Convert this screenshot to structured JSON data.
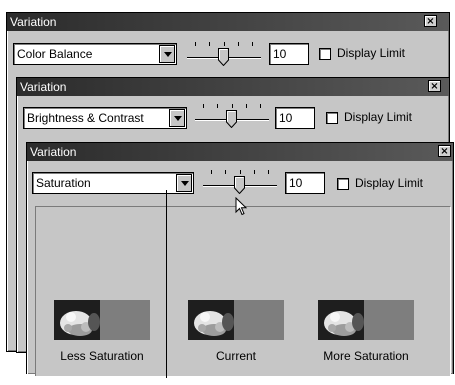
{
  "window1": {
    "title": "Variation",
    "close_glyph": "×",
    "mode": "Color Balance",
    "value": "10",
    "display_limit_label": "Display Limit",
    "display_limit_checked": false
  },
  "window2": {
    "title": "Variation",
    "close_glyph": "×",
    "mode": "Brightness & Contrast",
    "value": "10",
    "display_limit_label": "Display Limit",
    "display_limit_checked": false
  },
  "window3": {
    "title": "Variation",
    "close_glyph": "×",
    "mode": "Saturation",
    "value": "10",
    "display_limit_label": "Display Limit",
    "display_limit_checked": false,
    "thumbnails": [
      {
        "label": "Less Saturation",
        "variant": "less"
      },
      {
        "label": "Current",
        "variant": "current"
      },
      {
        "label": "More Saturation",
        "variant": "more"
      }
    ]
  },
  "icons": {
    "dropdown": "chevron-down-icon",
    "close": "close-icon",
    "cursor": "mouse-pointer-icon"
  }
}
